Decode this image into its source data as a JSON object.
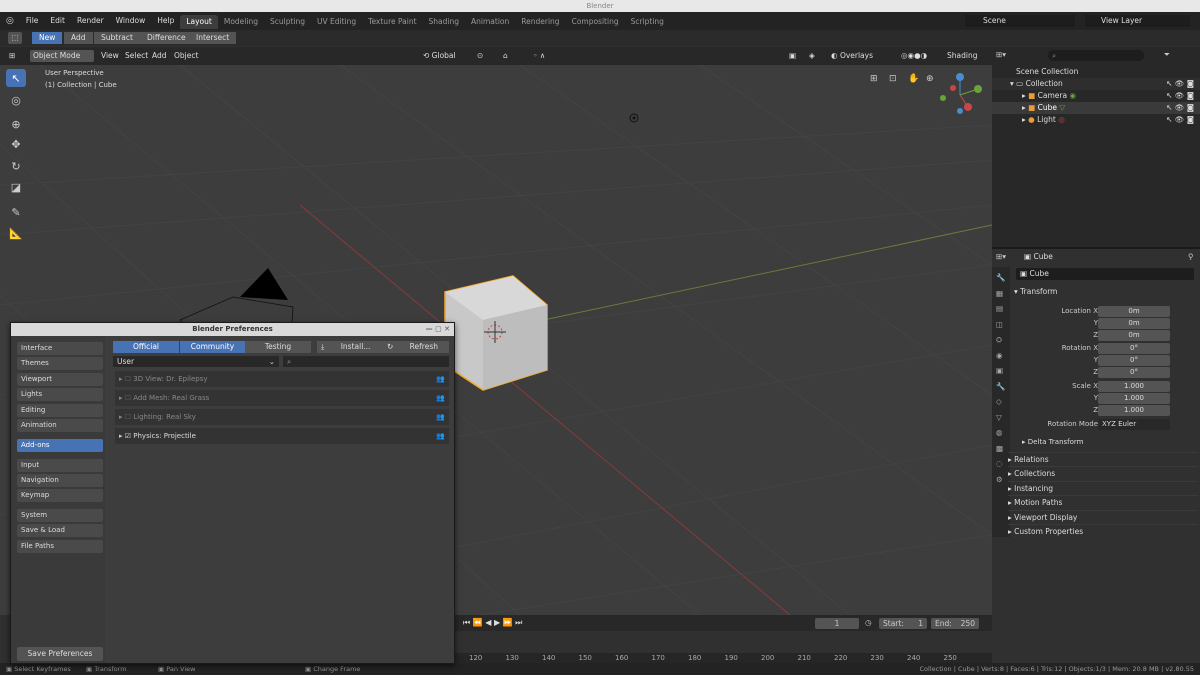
{
  "window_title": "Blender",
  "menu": [
    "File",
    "Edit",
    "Render",
    "Window",
    "Help"
  ],
  "workspaces": [
    "Layout",
    "Modeling",
    "Sculpting",
    "UV Editing",
    "Texture Paint",
    "Shading",
    "Animation",
    "Rendering",
    "Compositing",
    "Scripting"
  ],
  "active_workspace": "Layout",
  "scene_label": "Scene",
  "view_layer_label": "View Layer",
  "tool_header": {
    "new": "New",
    "add": "Add",
    "subtract": "Subtract",
    "difference": "Difference",
    "intersect": "Intersect"
  },
  "viewport_header": {
    "mode": "Object Mode",
    "view": "View",
    "select": "Select",
    "add": "Add",
    "object": "Object",
    "transform": "Global",
    "overlays": "Overlays",
    "shading": "Shading"
  },
  "viewport": {
    "perspective": "User Perspective",
    "collection": "(1) Collection | Cube"
  },
  "outliner": {
    "root": "Scene Collection",
    "collection": "Collection",
    "items": [
      {
        "name": "Camera"
      },
      {
        "name": "Cube"
      },
      {
        "name": "Light"
      }
    ]
  },
  "properties": {
    "object_name": "Cube",
    "data_name": "Cube",
    "transform_title": "Transform",
    "location": {
      "label": "Location X",
      "x": "0m",
      "y": "0m",
      "z": "0m"
    },
    "rotation": {
      "label": "Rotation X",
      "x": "0°",
      "y": "0°",
      "z": "0°"
    },
    "scale": {
      "label": "Scale X",
      "x": "1.000",
      "y": "1.000",
      "z": "1.000"
    },
    "axis_y": "Y",
    "axis_z": "Z",
    "rotation_mode_label": "Rotation Mode",
    "rotation_mode": "XYZ Euler",
    "delta": "Delta Transform",
    "sections": [
      "Relations",
      "Collections",
      "Instancing",
      "Motion Paths",
      "Viewport Display",
      "Custom Properties"
    ]
  },
  "timeline": {
    "frame": "1",
    "start_label": "Start:",
    "start": "1",
    "end_label": "End:",
    "end": "250",
    "ticks": [
      "120",
      "130",
      "140",
      "150",
      "160",
      "170",
      "180",
      "190",
      "200",
      "210",
      "220",
      "230",
      "240",
      "250"
    ]
  },
  "statusbar": {
    "select": "Select Keyframes",
    "transform": "Transform",
    "pan": "Pan View",
    "change": "Change Frame",
    "stats": "Collection | Cube | Verts:8 | Faces:6 | Tris:12 | Objects:1/3 | Mem: 20.8 MB | v2.80.55"
  },
  "prefs": {
    "title": "Blender Preferences",
    "categories": [
      "Interface",
      "Themes",
      "Viewport",
      "Lights",
      "Editing",
      "Animation"
    ],
    "categories2": [
      "Add-ons"
    ],
    "categories3": [
      "Input",
      "Navigation",
      "Keymap"
    ],
    "categories4": [
      "System",
      "Save & Load",
      "File Paths"
    ],
    "tabs": {
      "official": "Official",
      "community": "Community",
      "testing": "Testing"
    },
    "install": "Install...",
    "refresh": "Refresh",
    "filter": "User",
    "addons": [
      {
        "name": "3D View: Dr. Epilepsy",
        "enabled": false
      },
      {
        "name": "Add Mesh: Real Grass",
        "enabled": false
      },
      {
        "name": "Lighting: Real Sky",
        "enabled": false
      },
      {
        "name": "Physics: Projectile",
        "enabled": true
      }
    ],
    "save": "Save Preferences"
  },
  "colors": {
    "accent": "#4772b3",
    "selected_outline": "#f5a623"
  }
}
